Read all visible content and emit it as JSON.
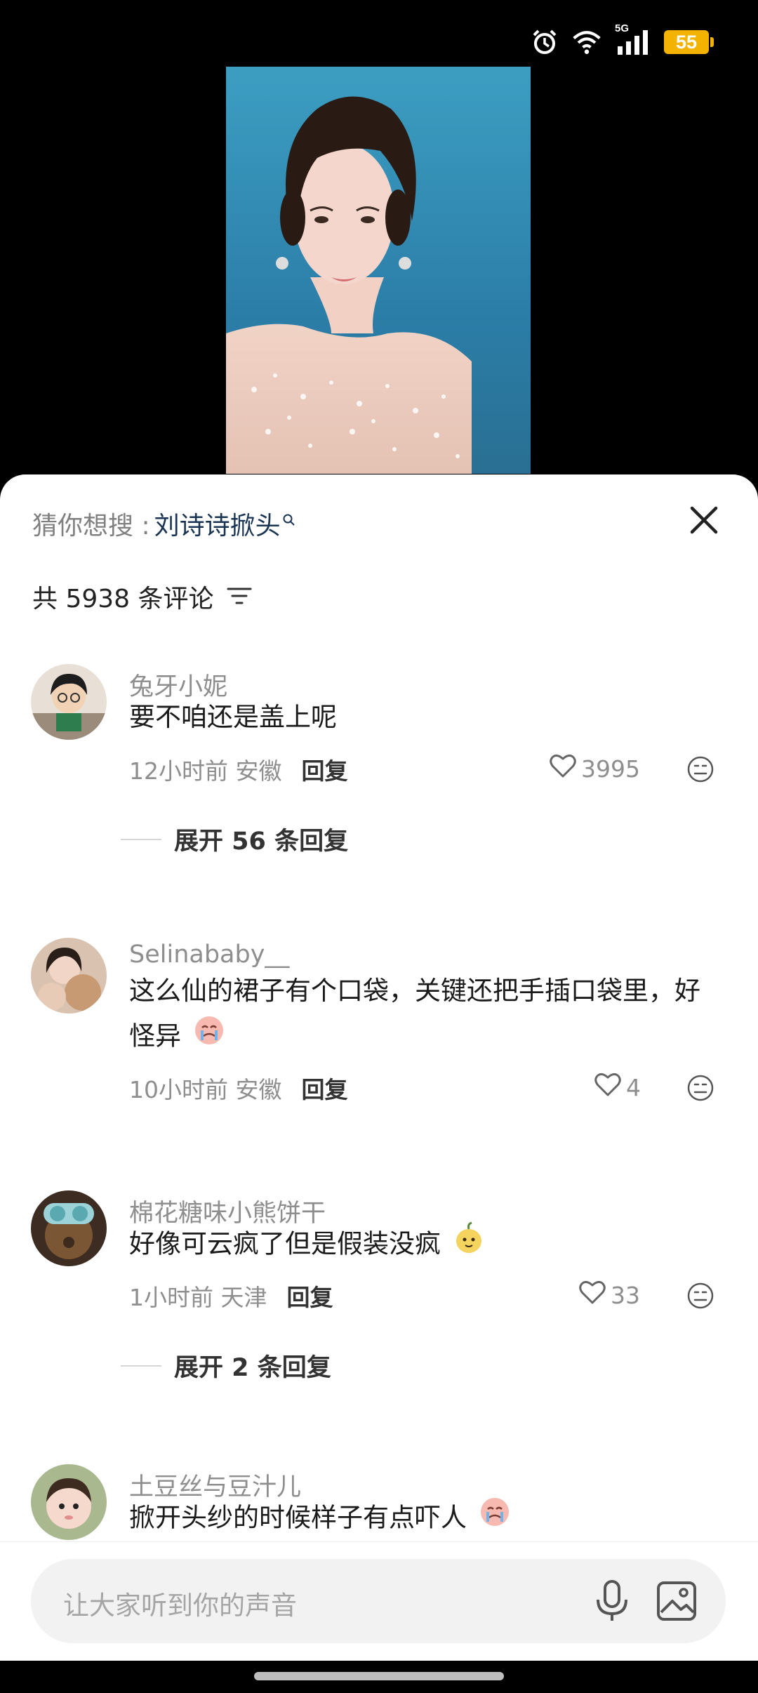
{
  "status": {
    "network": "5G",
    "battery": "55"
  },
  "sheet": {
    "search_label": "猜你想搜 :",
    "search_keyword": "刘诗诗掀头",
    "comment_count": "共 5938 条评论"
  },
  "comments": [
    {
      "user": "兔牙小妮",
      "text": "要不咱还是盖上呢",
      "time_location": "12小时前 安徽",
      "reply_label": "回复",
      "likes": "3995",
      "expand": "展开 56 条回复"
    },
    {
      "user": "Selinababy__",
      "text": "这么仙的裙子有个口袋，关键还把手插口袋里，好怪异",
      "time_location": "10小时前 安徽",
      "reply_label": "回复",
      "likes": "4"
    },
    {
      "user": "棉花糖味小熊饼干",
      "text": "好像可云疯了但是假装没疯",
      "time_location": "1小时前 天津",
      "reply_label": "回复",
      "likes": "33",
      "expand": "展开 2 条回复"
    },
    {
      "user": "土豆丝与豆汁儿",
      "text": "掀开头纱的时候样子有点吓人"
    }
  ],
  "input": {
    "placeholder": "让大家听到你的声音"
  },
  "icons": [
    "alarm-icon",
    "wifi-icon",
    "signal-icon",
    "battery-icon",
    "search-icon",
    "close-icon",
    "filter-icon",
    "heart-icon",
    "emoji-face-icon",
    "mic-icon",
    "image-icon"
  ]
}
